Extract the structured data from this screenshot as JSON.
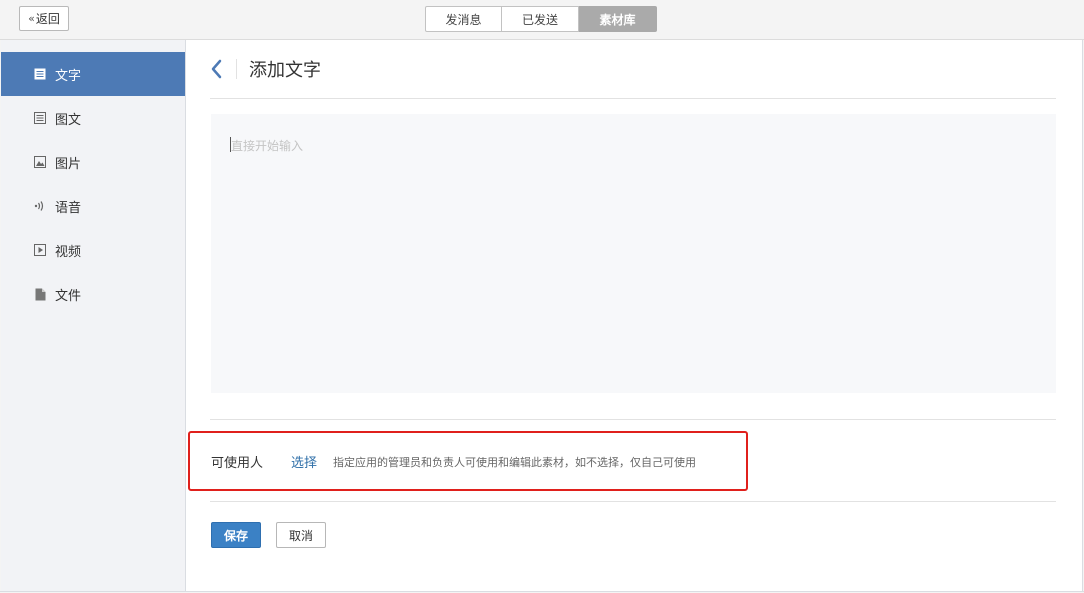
{
  "topbar": {
    "back_label": "返回",
    "tabs": [
      {
        "label": "发消息"
      },
      {
        "label": "已发送"
      },
      {
        "label": "素材库"
      }
    ]
  },
  "sidebar": {
    "items": [
      {
        "label": "文字",
        "icon": "text-doc-icon"
      },
      {
        "label": "图文",
        "icon": "article-icon"
      },
      {
        "label": "图片",
        "icon": "image-icon"
      },
      {
        "label": "语音",
        "icon": "audio-icon"
      },
      {
        "label": "视频",
        "icon": "video-icon"
      },
      {
        "label": "文件",
        "icon": "file-icon"
      }
    ]
  },
  "main": {
    "title": "添加文字",
    "editor_placeholder": "直接开始输入",
    "permission": {
      "label": "可使用人",
      "link": "选择",
      "description": "指定应用的管理员和负责人可使用和编辑此素材，如不选择，仅自己可使用"
    },
    "save_label": "保存",
    "cancel_label": "取消"
  },
  "colors": {
    "accent": "#4d7ab5",
    "primary_button": "#3b81c5",
    "link": "#2f6fa8",
    "highlight_border": "#e0201c"
  }
}
